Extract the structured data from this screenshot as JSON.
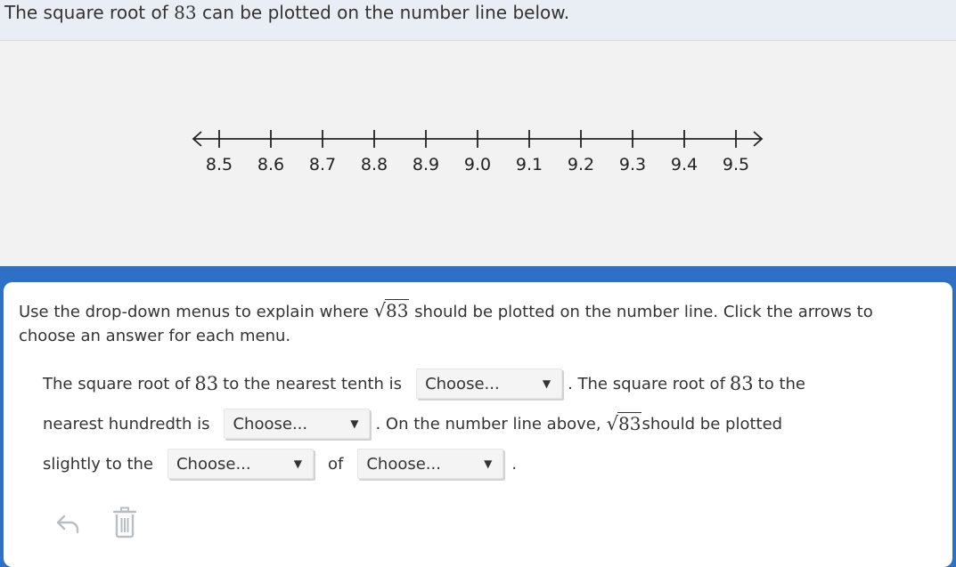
{
  "header": {
    "prompt_before": "The square root of ",
    "prompt_number": "83",
    "prompt_after": " can be plotted on the number line below."
  },
  "number_line": {
    "ticks": [
      "8.5",
      "8.6",
      "8.7",
      "8.8",
      "8.9",
      "9.0",
      "9.1",
      "9.2",
      "9.3",
      "9.4",
      "9.5"
    ]
  },
  "instructions": {
    "before": "Use the drop-down menus to explain where ",
    "radical_symbol": "√",
    "radicand": "83",
    "after": " should be plotted on the number line. Click the arrows to choose an answer for each menu."
  },
  "question": {
    "part1_before": "The square root of ",
    "part1_number": "83",
    "part1_after": " to the nearest tenth is",
    "part2_before": ". The square root of ",
    "part2_number": "83",
    "part2_after": " to the",
    "part3": "nearest hundredth is",
    "part4_before": ". On the number line above,",
    "part4_radicand": "83",
    "part4_after": " should be plotted",
    "part5": "slightly to the",
    "part6": "of",
    "end_period": "."
  },
  "dropdowns": {
    "tenth": "Choose...",
    "hundredth": "Choose...",
    "direction": "Choose...",
    "reference": "Choose..."
  },
  "toolbar": {
    "undo_icon": "undo-icon",
    "delete_icon": "trash-icon"
  }
}
